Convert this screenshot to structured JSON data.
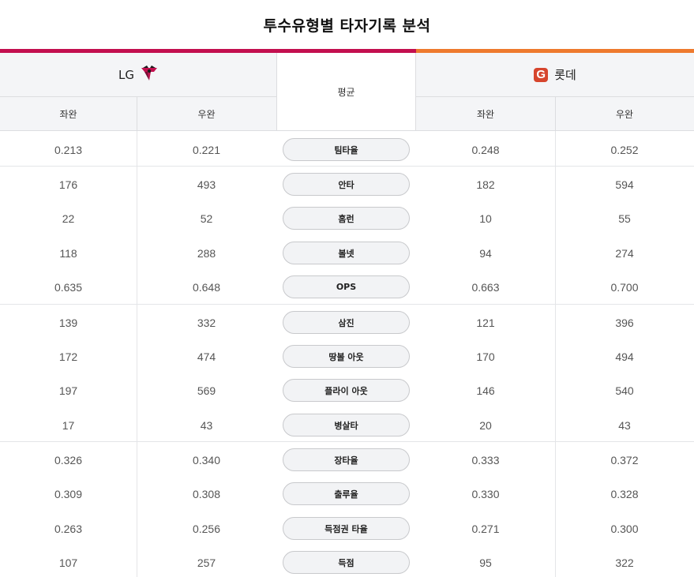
{
  "title": "투수유형별 타자기록 분석",
  "colors": {
    "lg_accent": "#c30f4f",
    "lotte_accent": "#ee7a2e",
    "lotte_logo_bg": "#d6452d"
  },
  "teams": {
    "left": {
      "name": "LG",
      "logo_icon": "lg-twins-logo-icon"
    },
    "right": {
      "name": "롯데",
      "logo_icon": "lotte-giants-logo-icon",
      "logo_letter": "G"
    }
  },
  "headers": {
    "average": "평균",
    "left_sub": [
      "좌완",
      "우완"
    ],
    "right_sub": [
      "좌완",
      "우완"
    ]
  },
  "rows": [
    {
      "label": "팀타율",
      "lg_left": "0.213",
      "lg_right": "0.221",
      "lt_left": "0.248",
      "lt_right": "0.252"
    },
    {
      "label": "안타",
      "lg_left": "176",
      "lg_right": "493",
      "lt_left": "182",
      "lt_right": "594"
    },
    {
      "label": "홈런",
      "lg_left": "22",
      "lg_right": "52",
      "lt_left": "10",
      "lt_right": "55"
    },
    {
      "label": "볼넷",
      "lg_left": "118",
      "lg_right": "288",
      "lt_left": "94",
      "lt_right": "274"
    },
    {
      "label": "OPS",
      "lg_left": "0.635",
      "lg_right": "0.648",
      "lt_left": "0.663",
      "lt_right": "0.700"
    },
    {
      "label": "삼진",
      "lg_left": "139",
      "lg_right": "332",
      "lt_left": "121",
      "lt_right": "396"
    },
    {
      "label": "땅볼 아웃",
      "lg_left": "172",
      "lg_right": "474",
      "lt_left": "170",
      "lt_right": "494"
    },
    {
      "label": "플라이 아웃",
      "lg_left": "197",
      "lg_right": "569",
      "lt_left": "146",
      "lt_right": "540"
    },
    {
      "label": "병살타",
      "lg_left": "17",
      "lg_right": "43",
      "lt_left": "20",
      "lt_right": "43"
    },
    {
      "label": "장타율",
      "lg_left": "0.326",
      "lg_right": "0.340",
      "lt_left": "0.333",
      "lt_right": "0.372"
    },
    {
      "label": "출루율",
      "lg_left": "0.309",
      "lg_right": "0.308",
      "lt_left": "0.330",
      "lt_right": "0.328"
    },
    {
      "label": "득점권 타율",
      "lg_left": "0.263",
      "lg_right": "0.256",
      "lt_left": "0.271",
      "lt_right": "0.300"
    },
    {
      "label": "득점",
      "lg_left": "107",
      "lg_right": "257",
      "lt_left": "95",
      "lt_right": "322"
    }
  ]
}
